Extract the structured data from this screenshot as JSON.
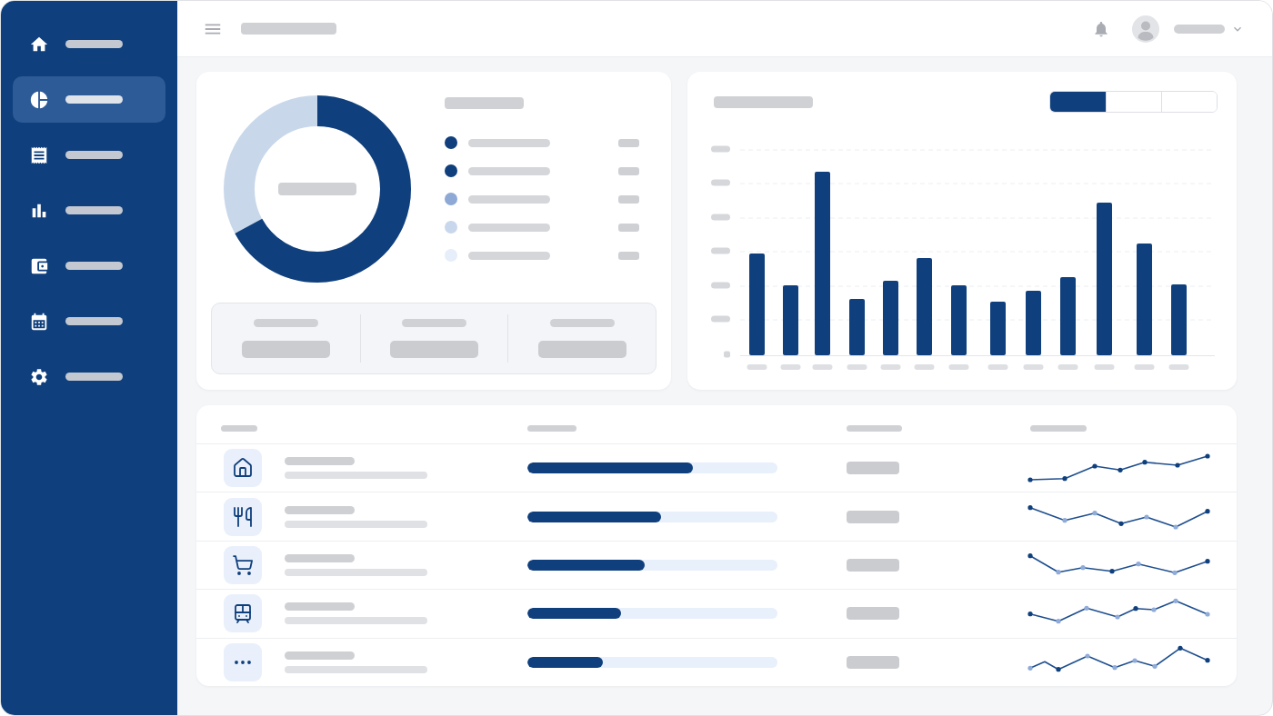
{
  "sidebar": {
    "items": [
      {
        "selected": false
      },
      {
        "selected": true
      },
      {
        "selected": false
      },
      {
        "selected": false
      },
      {
        "selected": false
      },
      {
        "selected": false
      },
      {
        "selected": false
      }
    ]
  },
  "breakdown_card": {
    "legend": [
      {
        "color": "#0f3f7c"
      },
      {
        "color": "#0f3f7c"
      },
      {
        "color": "#8ea9d6"
      },
      {
        "color": "#c9d7ec"
      },
      {
        "color": "#e6eef9"
      }
    ]
  },
  "chart_card": {
    "range_tabs": [
      {
        "selected": true
      },
      {
        "selected": false
      },
      {
        "selected": false
      }
    ]
  },
  "table": {
    "rows": [
      {
        "level": 0.66
      },
      {
        "level": 0.535
      },
      {
        "level": 0.47
      },
      {
        "level": 0.375
      },
      {
        "level": 0.3
      }
    ]
  }
}
